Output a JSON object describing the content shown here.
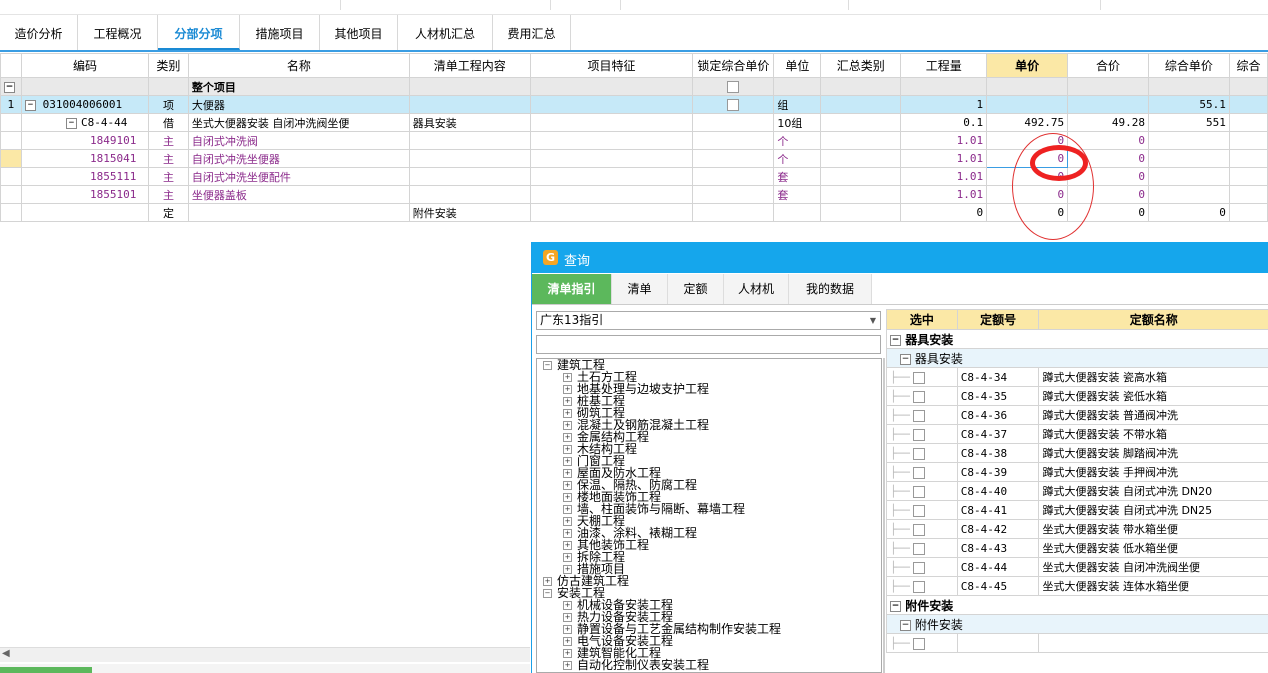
{
  "tabs": [
    {
      "label": "造价分析"
    },
    {
      "label": "工程概况"
    },
    {
      "label": "分部分项",
      "active": true
    },
    {
      "label": "措施项目"
    },
    {
      "label": "其他项目"
    },
    {
      "label": "人材机汇总"
    },
    {
      "label": "费用汇总"
    }
  ],
  "grid": {
    "headers": [
      "编码",
      "类别",
      "名称",
      "清单工程内容",
      "项目特征",
      "锁定综合单价",
      "单位",
      "汇总类别",
      "工程量",
      "单价",
      "合价",
      "综合单价",
      "综合"
    ],
    "rows": [
      {
        "idx": "",
        "code": "",
        "type": "",
        "name": "整个项目",
        "content": "",
        "feature": "",
        "lock": true,
        "unit": "",
        "sum": "",
        "qty": "",
        "price": "",
        "total": "",
        "comp": ""
      },
      {
        "idx": "1",
        "code": "031004006001",
        "type": "项",
        "name": "大便器",
        "content": "",
        "feature": "",
        "lock": true,
        "unit": "组",
        "sum": "",
        "qty": "1",
        "price": "",
        "total": "",
        "comp": "55.1"
      },
      {
        "idx": "",
        "code": "C8-4-44",
        "type": "借",
        "name": "坐式大便器安装 自闭冲洗阀坐便",
        "content": "器具安装",
        "feature": "",
        "lock": false,
        "unit": "10组",
        "sum": "",
        "qty": "0.1",
        "price": "492.75",
        "total": "49.28",
        "comp": "551"
      },
      {
        "idx": "",
        "code": "1849101",
        "type": "主",
        "name": "自闭式冲洗阀",
        "content": "",
        "feature": "",
        "lock": false,
        "unit": "个",
        "sum": "",
        "qty": "1.01",
        "price": "0",
        "total": "0",
        "comp": ""
      },
      {
        "idx": "",
        "code": "1815041",
        "type": "主",
        "name": "自闭式冲洗坐便器",
        "content": "",
        "feature": "",
        "lock": false,
        "unit": "个",
        "sum": "",
        "qty": "1.01",
        "price": "0",
        "total": "0",
        "comp": ""
      },
      {
        "idx": "",
        "code": "1855111",
        "type": "主",
        "name": "自闭式冲洗坐便配件",
        "content": "",
        "feature": "",
        "lock": false,
        "unit": "套",
        "sum": "",
        "qty": "1.01",
        "price": "0",
        "total": "0",
        "comp": ""
      },
      {
        "idx": "",
        "code": "1855101",
        "type": "主",
        "name": "坐便器盖板",
        "content": "",
        "feature": "",
        "lock": false,
        "unit": "套",
        "sum": "",
        "qty": "1.01",
        "price": "0",
        "total": "0",
        "comp": ""
      },
      {
        "idx": "",
        "code": "",
        "type": "定",
        "name": "",
        "content": "附件安装",
        "feature": "",
        "lock": false,
        "unit": "",
        "sum": "",
        "qty": "0",
        "price": "0",
        "total": "0",
        "comp": "0"
      }
    ]
  },
  "dialog": {
    "title": "查询",
    "tabs": [
      "清单指引",
      "清单",
      "定额",
      "人材机",
      "我的数据"
    ],
    "select_value": "广东13指引",
    "tree": [
      {
        "label": "建筑工程",
        "level": 0,
        "exp": "−"
      },
      {
        "label": "土石方工程",
        "level": 1,
        "exp": "+"
      },
      {
        "label": "地基处理与边坡支护工程",
        "level": 1,
        "exp": "+"
      },
      {
        "label": "桩基工程",
        "level": 1,
        "exp": "+"
      },
      {
        "label": "砌筑工程",
        "level": 1,
        "exp": "+"
      },
      {
        "label": "混凝土及钢筋混凝土工程",
        "level": 1,
        "exp": "+"
      },
      {
        "label": "金属结构工程",
        "level": 1,
        "exp": "+"
      },
      {
        "label": "木结构工程",
        "level": 1,
        "exp": "+"
      },
      {
        "label": "门窗工程",
        "level": 1,
        "exp": "+"
      },
      {
        "label": "屋面及防水工程",
        "level": 1,
        "exp": "+"
      },
      {
        "label": "保温、隔热、防腐工程",
        "level": 1,
        "exp": "+"
      },
      {
        "label": "楼地面装饰工程",
        "level": 1,
        "exp": "+"
      },
      {
        "label": "墙、柱面装饰与隔断、幕墙工程",
        "level": 1,
        "exp": "+"
      },
      {
        "label": "天棚工程",
        "level": 1,
        "exp": "+"
      },
      {
        "label": "油漆、涂料、裱糊工程",
        "level": 1,
        "exp": "+"
      },
      {
        "label": "其他装饰工程",
        "level": 1,
        "exp": "+"
      },
      {
        "label": "拆除工程",
        "level": 1,
        "exp": "+"
      },
      {
        "label": "措施项目",
        "level": 1,
        "exp": "+"
      },
      {
        "label": "仿古建筑工程",
        "level": 0,
        "exp": "+"
      },
      {
        "label": "安装工程",
        "level": 0,
        "exp": "−"
      },
      {
        "label": "机械设备安装工程",
        "level": 1,
        "exp": "+"
      },
      {
        "label": "热力设备安装工程",
        "level": 1,
        "exp": "+"
      },
      {
        "label": "静置设备与工艺金属结构制作安装工程",
        "level": 1,
        "exp": "+"
      },
      {
        "label": "电气设备安装工程",
        "level": 1,
        "exp": "+"
      },
      {
        "label": "建筑智能化工程",
        "level": 1,
        "exp": "+"
      },
      {
        "label": "自动化控制仪表安装工程",
        "level": 1,
        "exp": "+"
      }
    ],
    "right_headers": [
      "选中",
      "定额号",
      "定额名称"
    ],
    "groups": [
      {
        "name": "器具安装",
        "sub": "器具安装",
        "items": [
          {
            "code": "C8-4-34",
            "name": "蹲式大便器安装 瓷高水箱"
          },
          {
            "code": "C8-4-35",
            "name": "蹲式大便器安装 瓷低水箱"
          },
          {
            "code": "C8-4-36",
            "name": "蹲式大便器安装 普通阀冲洗"
          },
          {
            "code": "C8-4-37",
            "name": "蹲式大便器安装 不带水箱"
          },
          {
            "code": "C8-4-38",
            "name": "蹲式大便器安装 脚踏阀冲洗"
          },
          {
            "code": "C8-4-39",
            "name": "蹲式大便器安装 手押阀冲洗"
          },
          {
            "code": "C8-4-40",
            "name": "蹲式大便器安装 自闭式冲洗 DN20"
          },
          {
            "code": "C8-4-41",
            "name": "蹲式大便器安装 自闭式冲洗 DN25"
          },
          {
            "code": "C8-4-42",
            "name": "坐式大便器安装 带水箱坐便"
          },
          {
            "code": "C8-4-43",
            "name": "坐式大便器安装 低水箱坐便"
          },
          {
            "code": "C8-4-44",
            "name": "坐式大便器安装 自闭冲洗阀坐便"
          },
          {
            "code": "C8-4-45",
            "name": "坐式大便器安装 连体水箱坐便"
          }
        ]
      },
      {
        "name": "附件安装",
        "sub": "附件安装",
        "items": [
          {
            "code": "",
            "name": ""
          }
        ]
      }
    ]
  },
  "colors": {
    "accent": "#1a8ad4",
    "title_bar": "#15a6ec",
    "active_tab": "#5cb85c",
    "header_highlight": "#fbe8a6",
    "annotation": "#ee2222"
  }
}
